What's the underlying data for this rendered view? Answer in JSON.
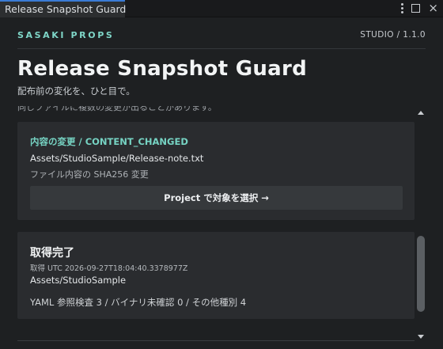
{
  "tab": {
    "title": "Release Snapshot Guard"
  },
  "header": {
    "brand": "SASAKI PROPS",
    "version": "STUDIO / 1.1.0",
    "title": "Release Snapshot Guard",
    "subtitle": "配布前の変化を、ひと目で。"
  },
  "clipped_text": "同じファイルに複数の変更が出ることがあります。",
  "change_card": {
    "change_type": "内容の変更 / CONTENT_CHANGED",
    "path": "Assets/StudioSample/Release-note.txt",
    "detail": "ファイル内容の SHA256 変更",
    "button_label": "Project で対象を選択 →"
  },
  "status_card": {
    "title": "取得完了",
    "timestamp": "取得 UTC  2026-09-27T18:04:40.3378977Z",
    "path": "Assets/StudioSample",
    "stats": "YAML 参照検査 3   /   バイナリ未確認 0   /   その他種別 4"
  },
  "scrollbar": {
    "position": 0.86
  }
}
